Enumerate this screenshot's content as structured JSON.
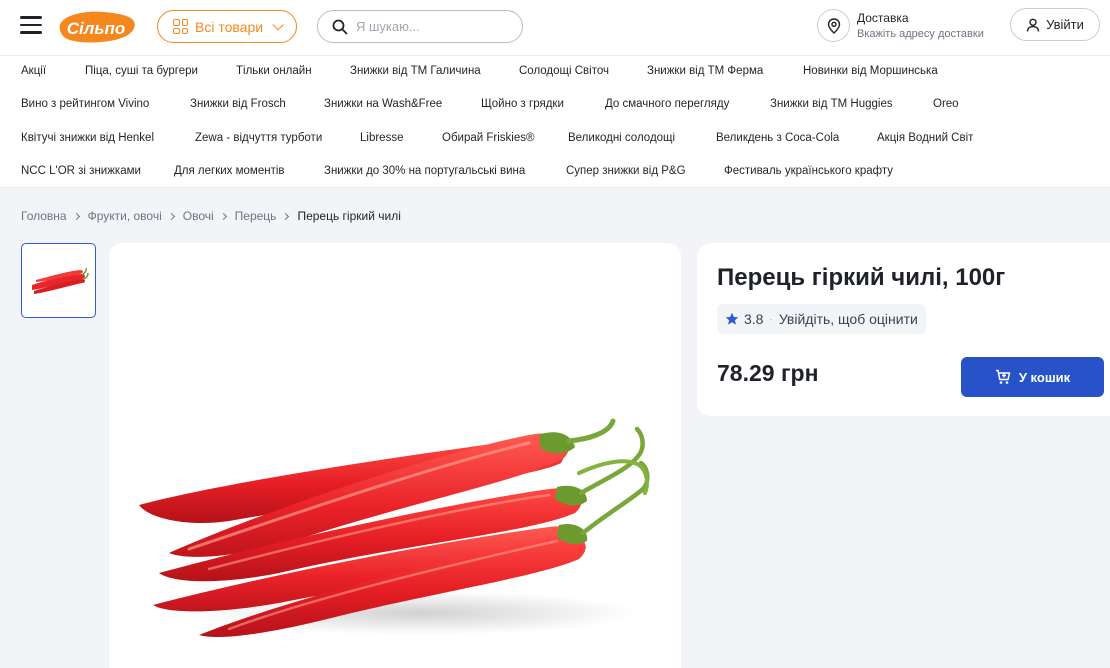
{
  "header": {
    "logo_text": "Сільпо",
    "all_goods_label": "Всі товари",
    "search_placeholder": "Я шукаю...",
    "delivery_title": "Доставка",
    "delivery_subtitle": "Вкажіть адресу доставки",
    "login_label": "Увійти"
  },
  "promo_rows": [
    [
      "Акції",
      "Піца, суші та бургери",
      "Тільки онлайн",
      "Знижки від ТМ Галичина",
      "Солодощі Світоч",
      "Знижки від ТМ Ферма",
      "Новинки від Моршинська"
    ],
    [
      "Вино з рейтингом Vivino",
      "Знижки від Frosch",
      "Знижки на Wash&Free",
      "Щойно з грядки",
      "До смачного перегляду",
      "Знижки від ТМ Huggies",
      "Oreo"
    ],
    [
      "Квітучі знижки від Henkel",
      "Zewa - відчуття турботи",
      "Libresse",
      "Обирай Friskies®",
      "Великодні солодощі",
      "Великдень з Coca-Cola",
      "Акція Водний Світ"
    ],
    [
      "NCC L'OR зі знижками",
      "Для легких моментів",
      "Знижки до 30% на португальські вина",
      "Супер знижки від P&G",
      "Фестиваль українського крафту"
    ]
  ],
  "breadcrumb": {
    "items": [
      "Головна",
      "Фрукти, овочі",
      "Овочі",
      "Перець"
    ],
    "current": "Перець гіркий чилі"
  },
  "product": {
    "title": "Перець гіркий чилі, 100г",
    "rating": "3.8",
    "rating_separator": "·",
    "rate_prompt": "Увійдіть, щоб оцінити",
    "price": "78.29 грн",
    "cart_label": "У кошик"
  },
  "colors": {
    "accent_orange": "#f5871f",
    "cart_blue": "#2853c8",
    "rating_star": "#2f5bd3"
  },
  "icons": [
    "burger-menu-icon",
    "grid-icon",
    "chevron-down-icon",
    "search-icon",
    "location-pin-icon",
    "user-icon",
    "star-icon",
    "cart-icon"
  ]
}
